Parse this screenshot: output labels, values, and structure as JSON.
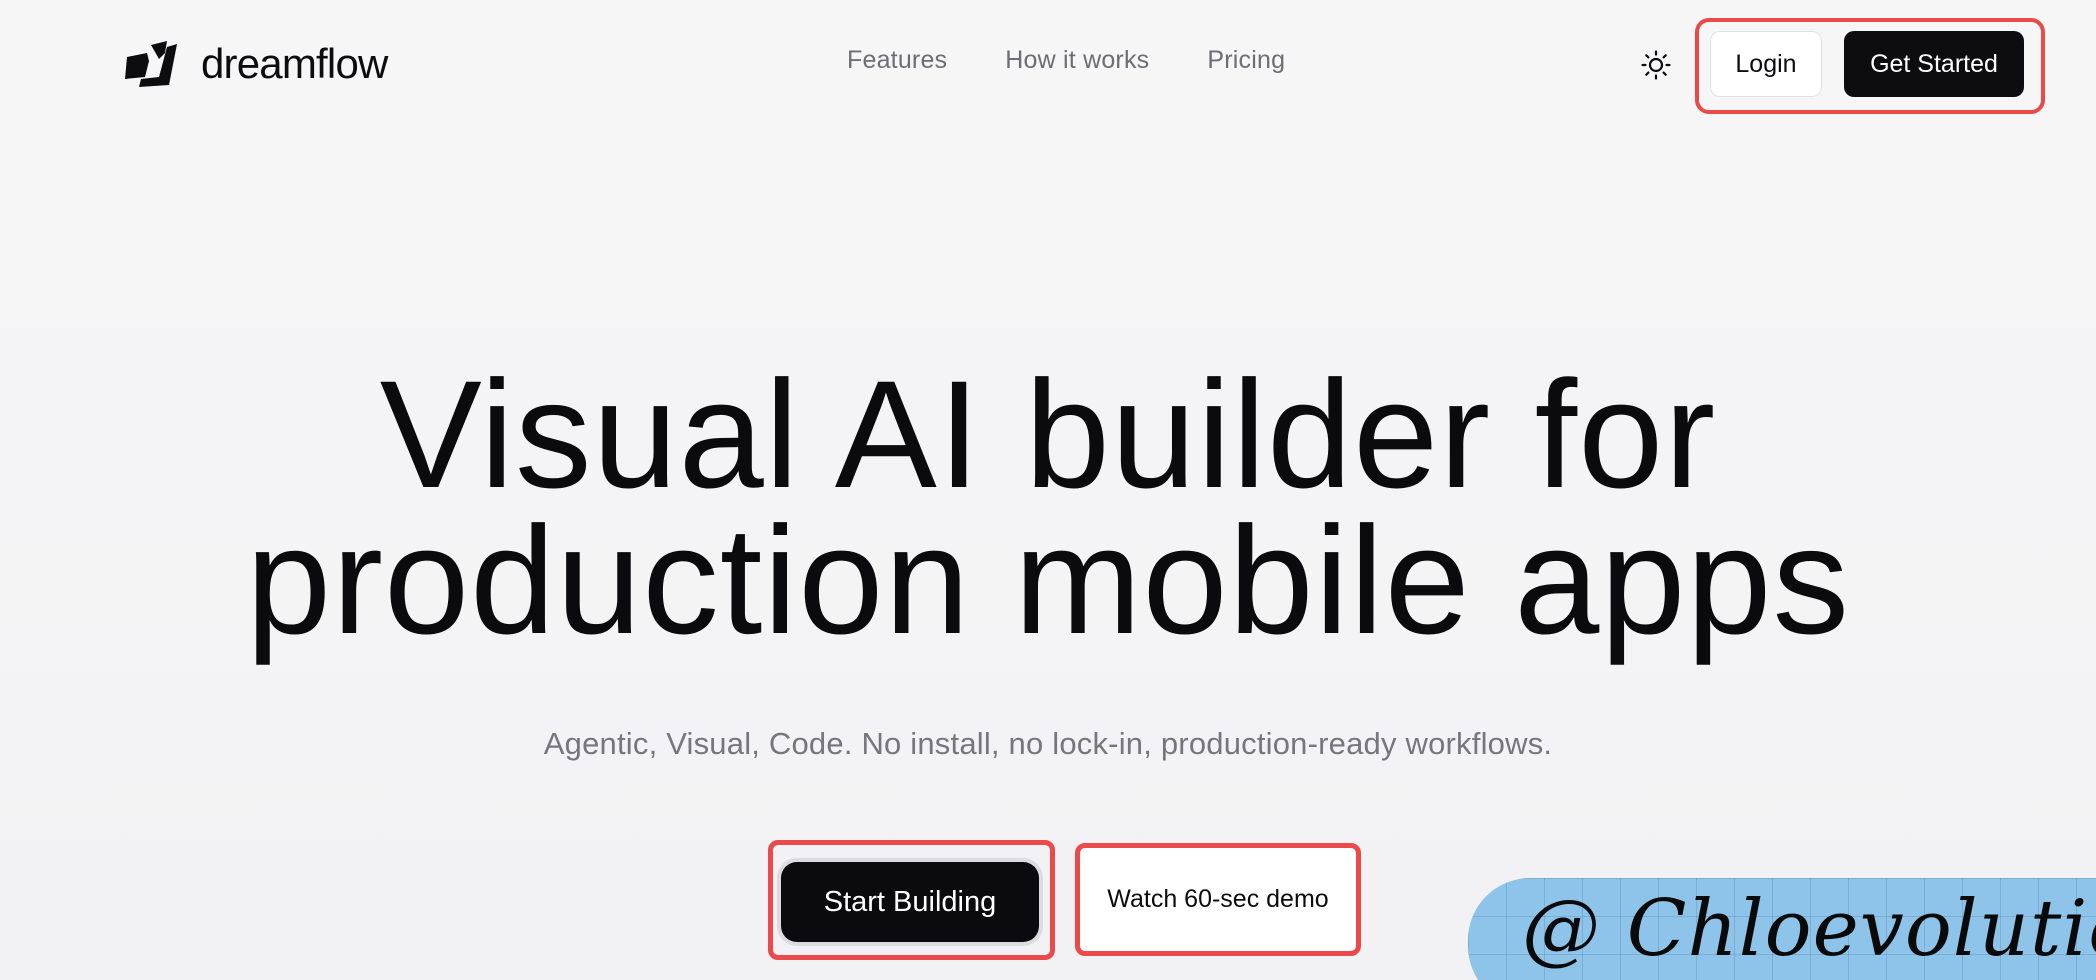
{
  "brand": {
    "name": "dreamflow",
    "logo_icon": "dreamflow-logo-mark"
  },
  "nav": {
    "items": [
      {
        "label": "Features"
      },
      {
        "label": "How it works"
      },
      {
        "label": "Pricing"
      }
    ]
  },
  "header": {
    "theme_toggle_icon": "sun-icon",
    "login_label": "Login",
    "get_started_label": "Get Started"
  },
  "hero": {
    "title_line1": "Visual AI builder for",
    "title_line2": "production mobile apps",
    "subtitle": "Agentic, Visual, Code. No install, no lock-in, production-ready workflows.",
    "primary_cta": "Start Building",
    "secondary_cta": "Watch 60-sec demo"
  },
  "watermark": {
    "text": "@ Chloevolution"
  },
  "colors": {
    "background": "#f4f4f5",
    "text": "#0b0b0d",
    "muted_text": "#6d6d73",
    "primary_button": "#0d0d0f",
    "highlight_outline": "#ec4a4a",
    "watermark_bg": "#8fc4ea"
  }
}
